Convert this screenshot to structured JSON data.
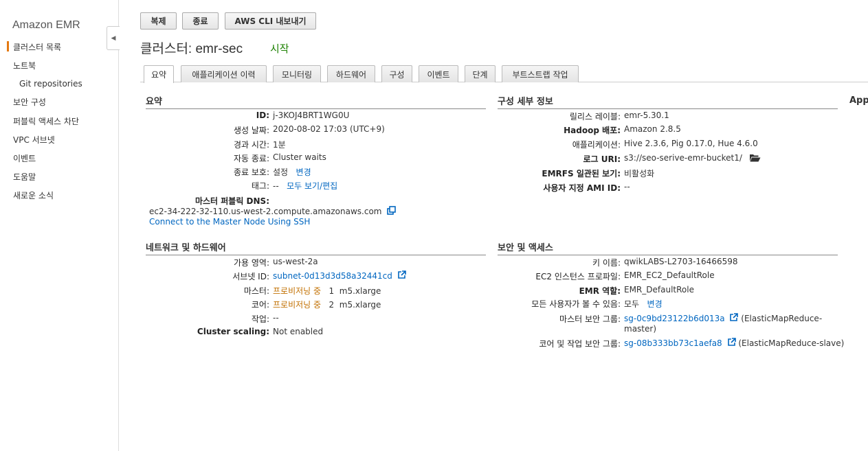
{
  "sidebar": {
    "title": "Amazon EMR",
    "items": [
      {
        "label": "클러스터 목록"
      },
      {
        "label": "노트북"
      },
      {
        "label": "Git repositories"
      },
      {
        "label": "보안 구성"
      },
      {
        "label": "퍼블릭 액세스 차단"
      },
      {
        "label": "VPC 서브넷"
      },
      {
        "label": "이벤트"
      },
      {
        "label": "도움말"
      },
      {
        "label": "새로운 소식"
      }
    ],
    "collapse_glyph": "◀"
  },
  "toolbar": {
    "clone_label": "복제",
    "terminate_label": "종료",
    "cli_export_label": "AWS CLI 내보내기"
  },
  "header": {
    "title": "클러스터: emr-sec",
    "status": "시작"
  },
  "tabs": [
    {
      "label": "요약",
      "active": true
    },
    {
      "label": "애플리케이션 이력"
    },
    {
      "label": "모니터링"
    },
    {
      "label": "하드웨어"
    },
    {
      "label": "구성"
    },
    {
      "label": "이벤트"
    },
    {
      "label": "단계"
    },
    {
      "label": "부트스트랩 작업"
    }
  ],
  "summary": {
    "title": "요약",
    "id_label": "ID:",
    "id_value": "j-3KOJ4BRT1WG0U",
    "created_label": "생성 날짜:",
    "created_value": "2020-08-02 17:03 (UTC+9)",
    "elapsed_label": "경과 시간:",
    "elapsed_value": "1분",
    "autoterm_label": "자동 종료:",
    "autoterm_value": "Cluster waits",
    "termprot_label": "종료 보호:",
    "termprot_value": "설정",
    "termprot_link": "변경",
    "tags_label": "태그:",
    "tags_value": "--",
    "tags_link": "모두 보기/편집",
    "dns_label": "마스터 퍼블릭 DNS:",
    "dns_value": "ec2-34-222-32-110.us-west-2.compute.amazonaws.com",
    "ssh_link": "Connect to the Master Node Using SSH"
  },
  "config": {
    "title": "구성 세부 정보",
    "release_label": "릴리스 레이블:",
    "release_value": "emr-5.30.1",
    "hadoop_label": "Hadoop 배포:",
    "hadoop_value": "Amazon 2.8.5",
    "apps_label": "애플리케이션:",
    "apps_value": "Hive 2.3.6, Pig 0.17.0, Hue 4.6.0",
    "log_label": "로그 URI:",
    "log_value": "s3://seo-serive-emr-bucket1/",
    "emrfs_label": "EMRFS 일관된 보기:",
    "emrfs_value": "비활성화",
    "ami_label": "사용자 지정 AMI ID:",
    "ami_value": "--"
  },
  "app_panel": {
    "title": "App"
  },
  "network": {
    "title": "네트워크 및 하드웨어",
    "az_label": "가용 영역:",
    "az_value": "us-west-2a",
    "subnet_label": "서브넷 ID:",
    "subnet_value": "subnet-0d13d3d58a32441cd",
    "master_label": "마스터:",
    "master_status": "프로비저닝 중",
    "master_value": "1  m5.xlarge",
    "core_label": "코어:",
    "core_status": "프로비저닝 중",
    "core_value": "2  m5.xlarge",
    "task_label": "작업:",
    "task_value": "--",
    "scaling_label": "Cluster scaling:",
    "scaling_value": "Not enabled"
  },
  "security": {
    "title": "보안 및 액세스",
    "key_label": "키 이름:",
    "key_value": "qwikLABS-L2703-16466598",
    "profile_label": "EC2 인스턴스 프로파일:",
    "profile_value": "EMR_EC2_DefaultRole",
    "role_label": "EMR 역할:",
    "role_value": "EMR_DefaultRole",
    "visible_label": "모든 사용자가 볼 수 있음:",
    "visible_value": "모두",
    "visible_link": "변경",
    "master_sg_label": "마스터 보안 그룹:",
    "master_sg_value": "sg-0c9bd23122b6d013a",
    "master_sg_suffix1": "(ElasticMapReduce-",
    "master_sg_suffix2": "master)",
    "core_sg_label": "코어 및 작업 보안 그룹:",
    "core_sg_value": "sg-08b333bb73c1aefa8",
    "core_sg_suffix": "(ElasticMapReduce-slave)"
  },
  "colors": {
    "accent": "#e47911",
    "link": "#0066c0",
    "status_green": "#1d8102",
    "provisioning": "#c27000"
  }
}
